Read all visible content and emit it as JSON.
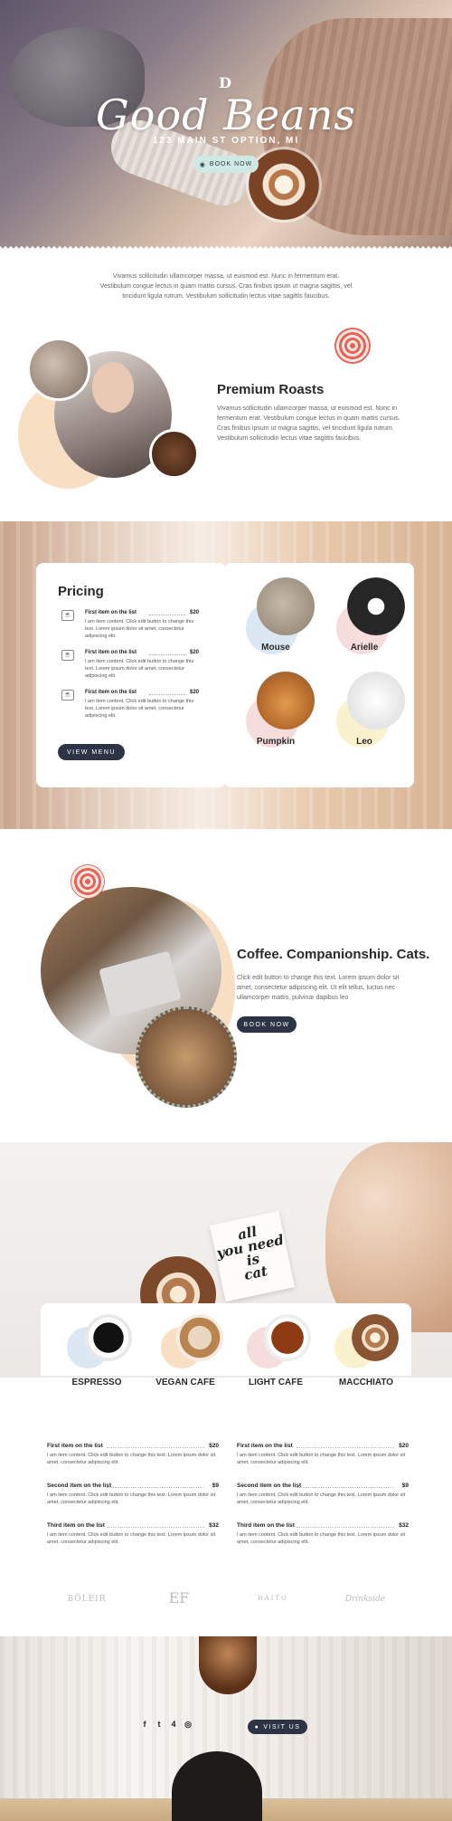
{
  "hero": {
    "logo_mark": "D",
    "title": "Good Beans",
    "address": "123 MAIN ST OPTION, MI",
    "book_label": "BOOK NOW"
  },
  "intro": {
    "text": "Vivamus sollicitudin ullamcorper massa, ut euismod est. Nunc in fermentum erat. Vestibulum congue lectus in quam mattis cursus. Cras finibus ipsum ut magna sagittis, vel tincidunt ligula rutrum. Vestibulum sollicitudin lectus vitae sagittis faucibus."
  },
  "roasts": {
    "title": "Premium Roasts",
    "text": "Vivamus sollicitudin ullamcorper massa, ut euismod est. Nunc in fermentum erat. Vestibulum congue lectus in quam mattis cursus. Cras finibus ipsum ut magna sagittis, vel tincidunt ligula rutrum. Vestibulum sollicitudin lectus vitae sagittis faucibus."
  },
  "pricing": {
    "title": "Pricing",
    "items": [
      {
        "name": "First item on the list",
        "price": "$20",
        "desc": "I am item content. Click edit button to change this text. Lorem ipsum dolor sit amet, consectetur adipiscing elit."
      },
      {
        "name": "First item on the list",
        "price": "$20",
        "desc": "I am item content. Click edit button to change this text. Lorem ipsum dolor sit amet, consectetur adipiscing elit."
      },
      {
        "name": "First item on the list",
        "price": "$20",
        "desc": "I am item content. Click edit button to change this text. Lorem ipsum dolor sit amet, consectetur adipiscing elit."
      }
    ],
    "view_menu_label": "VIEW MENU",
    "cats": [
      "Mouse",
      "Arielle",
      "Pumpkin",
      "Leo"
    ]
  },
  "companionship": {
    "title": "Coffee. Companionship. Cats.",
    "text": "Click edit button to change this text. Lorem ipsum dolor sit amet, consectetur adipiscing elit. Ut elit tellus, luctus nec ullamcorper mattis, pulvinar dapibus leo",
    "button_label": "BOOK NOW"
  },
  "note": {
    "line1": "all",
    "line2": "you need",
    "line3": "is",
    "line4": "cat"
  },
  "drinks": [
    "ESPRESSO",
    "VEGAN CAFE",
    "LIGHT CAFE",
    "MACCHIATO"
  ],
  "menu": {
    "items": [
      {
        "name": "First item on the list",
        "price": "$20",
        "desc": "I am item content. Click edit button to change this text. Lorem ipsum dolor sit amet, consectetur adipiscing elit."
      },
      {
        "name": "First item on the list",
        "price": "$20",
        "desc": "I am item content. Click edit button to change this text. Lorem ipsum dolor sit amet, consectetur adipiscing elit."
      },
      {
        "name": "Second item on the list",
        "price": "$9",
        "desc": "I am item content. Click edit button to change this text. Lorem ipsum dolor sit amet, consectetur adipiscing elit."
      },
      {
        "name": "Second item on the list",
        "price": "$9",
        "desc": "I am item content. Click edit button to change this text. Lorem ipsum dolor sit amet, consectetur adipiscing elit."
      },
      {
        "name": "Third item on the list",
        "price": "$32",
        "desc": "I am item content. Click edit button to change this text. Lorem ipsum dolor sit amet, consectetur adipiscing elit."
      },
      {
        "name": "Third item on the list",
        "price": "$32",
        "desc": "I am item content. Click edit button to change this text. Lorem ipsum dolor sit amet, consectetur adipiscing elit."
      }
    ]
  },
  "logos": [
    "BÖLEIR",
    "EF",
    "RAITO",
    "Drinkside"
  ],
  "footer": {
    "social_icons": [
      "facebook-icon",
      "twitter-icon",
      "foursquare-icon",
      "instagram-icon"
    ],
    "social_glyphs": [
      "f",
      "t",
      "4",
      "◎"
    ],
    "visit_label": "VISIT US"
  },
  "colors": {
    "dark_button": "#2d3446",
    "mint_button": "#cfe8e3",
    "peach": "#f8dfc4",
    "swirl_red": "#e46458"
  }
}
